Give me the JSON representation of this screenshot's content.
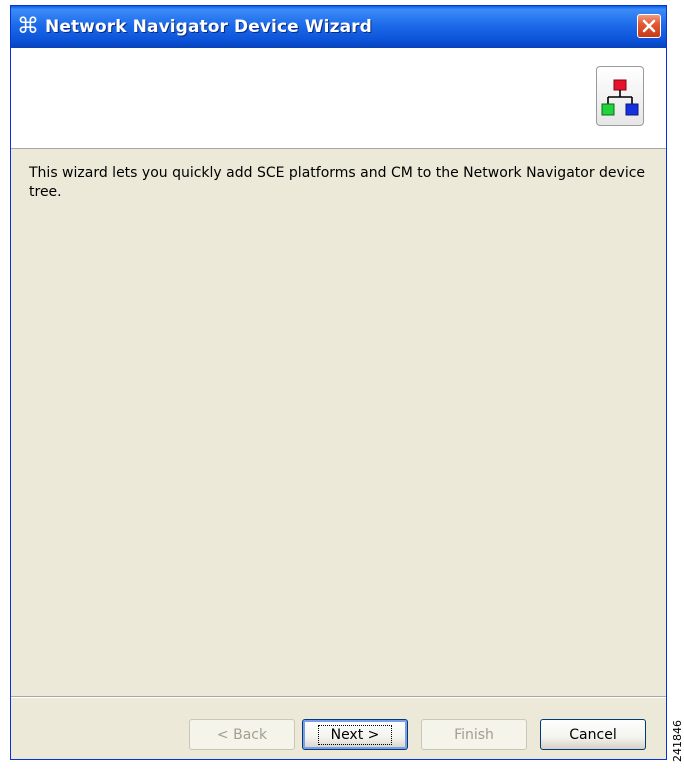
{
  "window": {
    "title": "Network Navigator Device Wizard",
    "app_icon": "command-icon",
    "close_icon": "close-icon"
  },
  "banner": {
    "icon": "network-tree-icon"
  },
  "content": {
    "message": "This wizard lets you quickly add SCE platforms and CM to the Network Navigator device tree."
  },
  "buttons": {
    "back": {
      "label": "< Back",
      "enabled": false
    },
    "next": {
      "label": "Next >",
      "enabled": true,
      "default": true
    },
    "finish": {
      "label": "Finish",
      "enabled": false
    },
    "cancel": {
      "label": "Cancel",
      "enabled": true
    }
  },
  "figure_id": "241846",
  "colors": {
    "titlebar": "#0a50d6",
    "dialog_bg": "#ece9d8",
    "close_button": "#e35a33"
  }
}
